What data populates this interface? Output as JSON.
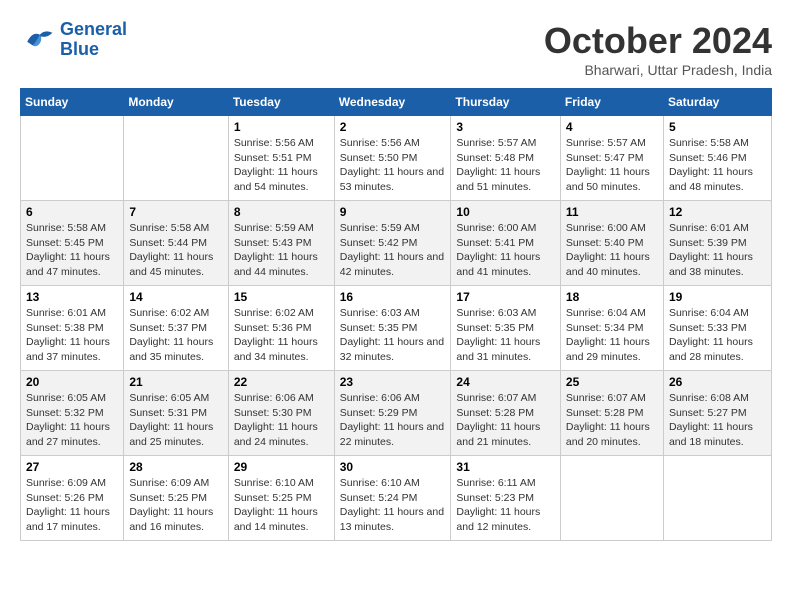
{
  "logo": {
    "line1": "General",
    "line2": "Blue"
  },
  "title": "October 2024",
  "subtitle": "Bharwari, Uttar Pradesh, India",
  "weekdays": [
    "Sunday",
    "Monday",
    "Tuesday",
    "Wednesday",
    "Thursday",
    "Friday",
    "Saturday"
  ],
  "weeks": [
    [
      {
        "day": "",
        "sunrise": "",
        "sunset": "",
        "daylight": ""
      },
      {
        "day": "",
        "sunrise": "",
        "sunset": "",
        "daylight": ""
      },
      {
        "day": "1",
        "sunrise": "Sunrise: 5:56 AM",
        "sunset": "Sunset: 5:51 PM",
        "daylight": "Daylight: 11 hours and 54 minutes."
      },
      {
        "day": "2",
        "sunrise": "Sunrise: 5:56 AM",
        "sunset": "Sunset: 5:50 PM",
        "daylight": "Daylight: 11 hours and 53 minutes."
      },
      {
        "day": "3",
        "sunrise": "Sunrise: 5:57 AM",
        "sunset": "Sunset: 5:48 PM",
        "daylight": "Daylight: 11 hours and 51 minutes."
      },
      {
        "day": "4",
        "sunrise": "Sunrise: 5:57 AM",
        "sunset": "Sunset: 5:47 PM",
        "daylight": "Daylight: 11 hours and 50 minutes."
      },
      {
        "day": "5",
        "sunrise": "Sunrise: 5:58 AM",
        "sunset": "Sunset: 5:46 PM",
        "daylight": "Daylight: 11 hours and 48 minutes."
      }
    ],
    [
      {
        "day": "6",
        "sunrise": "Sunrise: 5:58 AM",
        "sunset": "Sunset: 5:45 PM",
        "daylight": "Daylight: 11 hours and 47 minutes."
      },
      {
        "day": "7",
        "sunrise": "Sunrise: 5:58 AM",
        "sunset": "Sunset: 5:44 PM",
        "daylight": "Daylight: 11 hours and 45 minutes."
      },
      {
        "day": "8",
        "sunrise": "Sunrise: 5:59 AM",
        "sunset": "Sunset: 5:43 PM",
        "daylight": "Daylight: 11 hours and 44 minutes."
      },
      {
        "day": "9",
        "sunrise": "Sunrise: 5:59 AM",
        "sunset": "Sunset: 5:42 PM",
        "daylight": "Daylight: 11 hours and 42 minutes."
      },
      {
        "day": "10",
        "sunrise": "Sunrise: 6:00 AM",
        "sunset": "Sunset: 5:41 PM",
        "daylight": "Daylight: 11 hours and 41 minutes."
      },
      {
        "day": "11",
        "sunrise": "Sunrise: 6:00 AM",
        "sunset": "Sunset: 5:40 PM",
        "daylight": "Daylight: 11 hours and 40 minutes."
      },
      {
        "day": "12",
        "sunrise": "Sunrise: 6:01 AM",
        "sunset": "Sunset: 5:39 PM",
        "daylight": "Daylight: 11 hours and 38 minutes."
      }
    ],
    [
      {
        "day": "13",
        "sunrise": "Sunrise: 6:01 AM",
        "sunset": "Sunset: 5:38 PM",
        "daylight": "Daylight: 11 hours and 37 minutes."
      },
      {
        "day": "14",
        "sunrise": "Sunrise: 6:02 AM",
        "sunset": "Sunset: 5:37 PM",
        "daylight": "Daylight: 11 hours and 35 minutes."
      },
      {
        "day": "15",
        "sunrise": "Sunrise: 6:02 AM",
        "sunset": "Sunset: 5:36 PM",
        "daylight": "Daylight: 11 hours and 34 minutes."
      },
      {
        "day": "16",
        "sunrise": "Sunrise: 6:03 AM",
        "sunset": "Sunset: 5:35 PM",
        "daylight": "Daylight: 11 hours and 32 minutes."
      },
      {
        "day": "17",
        "sunrise": "Sunrise: 6:03 AM",
        "sunset": "Sunset: 5:35 PM",
        "daylight": "Daylight: 11 hours and 31 minutes."
      },
      {
        "day": "18",
        "sunrise": "Sunrise: 6:04 AM",
        "sunset": "Sunset: 5:34 PM",
        "daylight": "Daylight: 11 hours and 29 minutes."
      },
      {
        "day": "19",
        "sunrise": "Sunrise: 6:04 AM",
        "sunset": "Sunset: 5:33 PM",
        "daylight": "Daylight: 11 hours and 28 minutes."
      }
    ],
    [
      {
        "day": "20",
        "sunrise": "Sunrise: 6:05 AM",
        "sunset": "Sunset: 5:32 PM",
        "daylight": "Daylight: 11 hours and 27 minutes."
      },
      {
        "day": "21",
        "sunrise": "Sunrise: 6:05 AM",
        "sunset": "Sunset: 5:31 PM",
        "daylight": "Daylight: 11 hours and 25 minutes."
      },
      {
        "day": "22",
        "sunrise": "Sunrise: 6:06 AM",
        "sunset": "Sunset: 5:30 PM",
        "daylight": "Daylight: 11 hours and 24 minutes."
      },
      {
        "day": "23",
        "sunrise": "Sunrise: 6:06 AM",
        "sunset": "Sunset: 5:29 PM",
        "daylight": "Daylight: 11 hours and 22 minutes."
      },
      {
        "day": "24",
        "sunrise": "Sunrise: 6:07 AM",
        "sunset": "Sunset: 5:28 PM",
        "daylight": "Daylight: 11 hours and 21 minutes."
      },
      {
        "day": "25",
        "sunrise": "Sunrise: 6:07 AM",
        "sunset": "Sunset: 5:28 PM",
        "daylight": "Daylight: 11 hours and 20 minutes."
      },
      {
        "day": "26",
        "sunrise": "Sunrise: 6:08 AM",
        "sunset": "Sunset: 5:27 PM",
        "daylight": "Daylight: 11 hours and 18 minutes."
      }
    ],
    [
      {
        "day": "27",
        "sunrise": "Sunrise: 6:09 AM",
        "sunset": "Sunset: 5:26 PM",
        "daylight": "Daylight: 11 hours and 17 minutes."
      },
      {
        "day": "28",
        "sunrise": "Sunrise: 6:09 AM",
        "sunset": "Sunset: 5:25 PM",
        "daylight": "Daylight: 11 hours and 16 minutes."
      },
      {
        "day": "29",
        "sunrise": "Sunrise: 6:10 AM",
        "sunset": "Sunset: 5:25 PM",
        "daylight": "Daylight: 11 hours and 14 minutes."
      },
      {
        "day": "30",
        "sunrise": "Sunrise: 6:10 AM",
        "sunset": "Sunset: 5:24 PM",
        "daylight": "Daylight: 11 hours and 13 minutes."
      },
      {
        "day": "31",
        "sunrise": "Sunrise: 6:11 AM",
        "sunset": "Sunset: 5:23 PM",
        "daylight": "Daylight: 11 hours and 12 minutes."
      },
      {
        "day": "",
        "sunrise": "",
        "sunset": "",
        "daylight": ""
      },
      {
        "day": "",
        "sunrise": "",
        "sunset": "",
        "daylight": ""
      }
    ]
  ]
}
